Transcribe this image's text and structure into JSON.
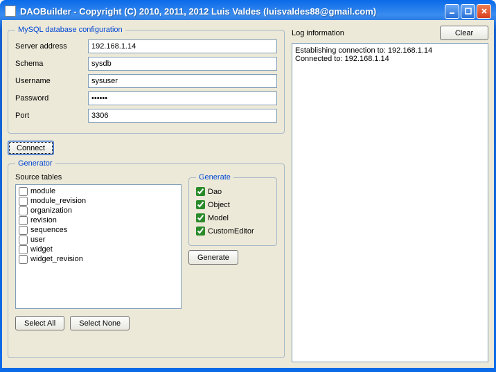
{
  "title": "DAOBuilder - Copyright (C) 2010, 2011, 2012  Luis Valdes (luisvaldes88@gmail.com)",
  "mysql": {
    "legend": "MySQL database configuration",
    "server_label": "Server address",
    "server_value": "192.168.1.14",
    "schema_label": "Schema",
    "schema_value": "sysdb",
    "username_label": "Username",
    "username_value": "sysuser",
    "password_label": "Password",
    "password_value": "••••••",
    "port_label": "Port",
    "port_value": "3306"
  },
  "connect_label": "Connect",
  "generator": {
    "legend": "Generator",
    "source_label": "Source tables",
    "items": [
      "module",
      "module_revision",
      "organization",
      "revision",
      "sequences",
      "user",
      "widget",
      "widget_revision"
    ],
    "select_all": "Select All",
    "select_none": "Select None",
    "generate_legend": "Generate",
    "checks": {
      "dao": "Dao",
      "object": "Object",
      "model": "Model",
      "customeditor": "CustomEditor"
    },
    "generate_btn": "Generate"
  },
  "log": {
    "label": "Log information",
    "clear": "Clear",
    "content": "Establishing connection to: 192.168.1.14\nConnected to: 192.168.1.14"
  }
}
